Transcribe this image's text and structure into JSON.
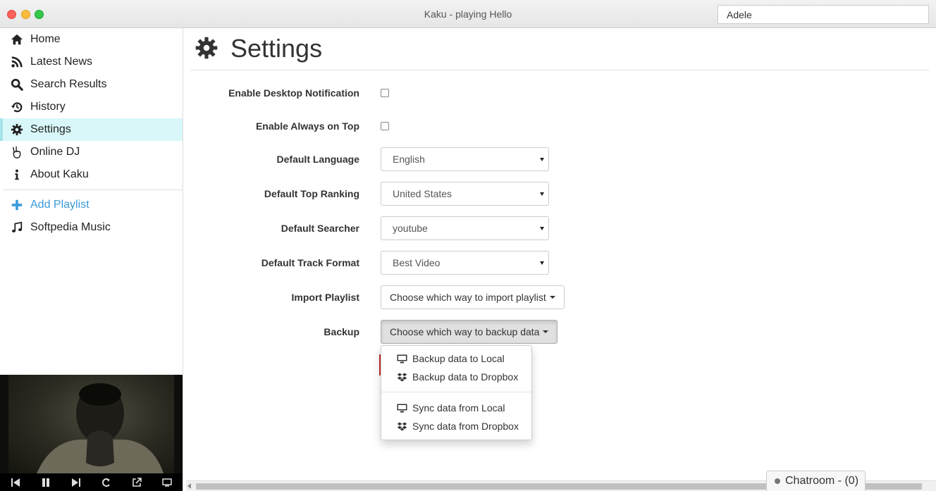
{
  "window": {
    "title": "Kaku - playing Hello"
  },
  "search": {
    "value": "Adele"
  },
  "sidebar": {
    "items": [
      {
        "label": "Home",
        "icon": "home-icon"
      },
      {
        "label": "Latest News",
        "icon": "rss-icon"
      },
      {
        "label": "Search Results",
        "icon": "search-icon"
      },
      {
        "label": "History",
        "icon": "history-icon"
      },
      {
        "label": "Settings",
        "icon": "gear-icon",
        "active": true
      },
      {
        "label": "Online DJ",
        "icon": "hand-peace-icon"
      },
      {
        "label": "About Kaku",
        "icon": "info-icon"
      }
    ],
    "playlists": [
      {
        "label": "Add Playlist",
        "icon": "plus-icon"
      },
      {
        "label": "Softpedia Music",
        "icon": "music-icon"
      }
    ]
  },
  "page": {
    "title": "Settings"
  },
  "settings": {
    "desktop_notification": {
      "label": "Enable Desktop Notification",
      "checked": false
    },
    "always_on_top": {
      "label": "Enable Always on Top",
      "checked": false
    },
    "language": {
      "label": "Default Language",
      "value": "English"
    },
    "top_ranking": {
      "label": "Default Top Ranking",
      "value": "United States"
    },
    "searcher": {
      "label": "Default Searcher",
      "value": "youtube"
    },
    "track_format": {
      "label": "Default Track Format",
      "value": "Best Video"
    },
    "import_playlist": {
      "label": "Import Playlist",
      "button": "Choose which way to import playlist"
    },
    "backup": {
      "label": "Backup",
      "button": "Choose which way to backup data",
      "menu": {
        "backup_local": "Backup data to Local",
        "backup_dropbox": "Backup data to Dropbox",
        "sync_local": "Sync data from Local",
        "sync_dropbox": "Sync data from Dropbox"
      }
    }
  },
  "chatroom": {
    "label": "Chatroom - (0)"
  },
  "colors": {
    "accent": "#3a9ad9",
    "active_bg": "#d9f7f9"
  }
}
